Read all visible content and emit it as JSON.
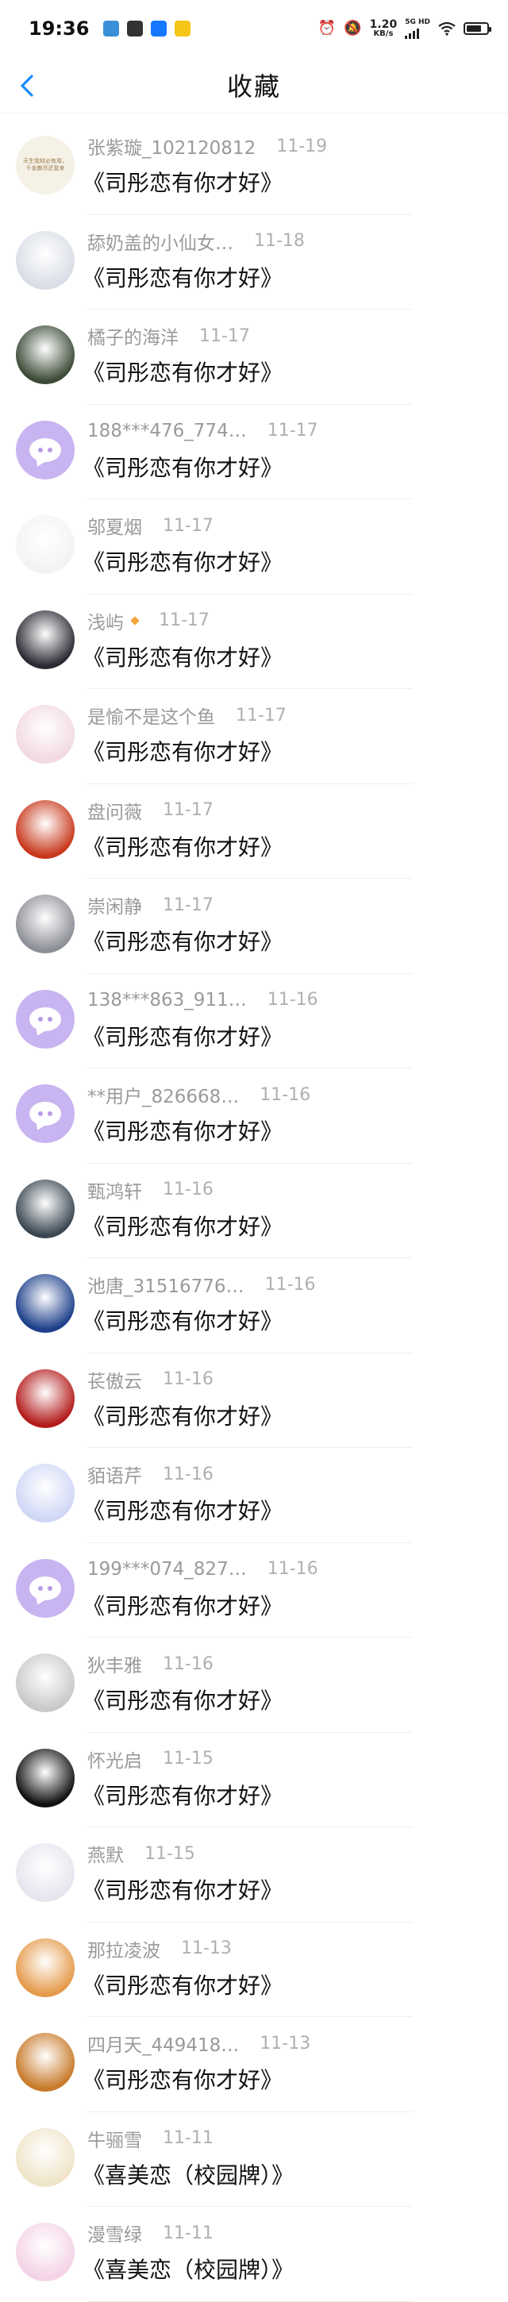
{
  "status_bar": {
    "time": "19:36",
    "net_speed": "1.20",
    "net_unit": "KB/s",
    "signal_badge": "5G HD",
    "app_icons": [
      {
        "name": "cloud-app-icon",
        "color": "#3a8fd9"
      },
      {
        "name": "mail-app-icon",
        "color": "#333333"
      },
      {
        "name": "bluetooth-app-icon",
        "color": "#1677ff"
      },
      {
        "name": "notes-app-icon",
        "color": "#f5c518"
      }
    ],
    "battery_level": 0.75
  },
  "header": {
    "back_icon": "chevron-left-icon",
    "title": "收藏",
    "accent_color": "#1a8cff"
  },
  "favorites": [
    {
      "name": "张紫璇_102120812",
      "date": "11-19",
      "title": "《司彤恋有你才好》",
      "avatar": {
        "type": "text",
        "bg": "#f6f1e6",
        "text": "天生我材必有用，千金散尽还复来"
      }
    },
    {
      "name": "舔奶盖的小仙女…",
      "date": "11-18",
      "title": "《司彤恋有你才好》",
      "avatar": {
        "type": "photo",
        "bg": "#d9dde5"
      }
    },
    {
      "name": "橘子的海洋",
      "date": "11-17",
      "title": "《司彤恋有你才好》",
      "avatar": {
        "type": "photo",
        "bg": "#3b4a36"
      }
    },
    {
      "name": "188***476_774…",
      "date": "11-17",
      "title": "《司彤恋有你才好》",
      "avatar": {
        "type": "default"
      }
    },
    {
      "name": "邬夏烟",
      "date": "11-17",
      "title": "《司彤恋有你才好》",
      "avatar": {
        "type": "photo",
        "bg": "#f3f3f3"
      }
    },
    {
      "name": "浅屿",
      "date": "11-17",
      "title": "《司彤恋有你才好》",
      "badge": true,
      "avatar": {
        "type": "photo",
        "bg": "#2a2a33"
      }
    },
    {
      "name": "是愉不是这个鱼",
      "date": "11-17",
      "title": "《司彤恋有你才好》",
      "avatar": {
        "type": "photo",
        "bg": "#f2d9e2"
      }
    },
    {
      "name": "盘问薇",
      "date": "11-17",
      "title": "《司彤恋有你才好》",
      "avatar": {
        "type": "photo",
        "bg": "#c8381c"
      }
    },
    {
      "name": "崇闲静",
      "date": "11-17",
      "title": "《司彤恋有你才好》",
      "avatar": {
        "type": "photo",
        "bg": "#8d8f96"
      }
    },
    {
      "name": "138***863_911…",
      "date": "11-16",
      "title": "《司彤恋有你才好》",
      "avatar": {
        "type": "default"
      }
    },
    {
      "name": "**用户_826668…",
      "date": "11-16",
      "title": "《司彤恋有你才好》",
      "avatar": {
        "type": "default"
      }
    },
    {
      "name": "甄鸿轩",
      "date": "11-16",
      "title": "《司彤恋有你才好》",
      "avatar": {
        "type": "photo",
        "bg": "#3a4752"
      }
    },
    {
      "name": "池唐_31516776…",
      "date": "11-16",
      "title": "《司彤恋有你才好》",
      "avatar": {
        "type": "photo",
        "bg": "#1d3f8a"
      }
    },
    {
      "name": "苌傲云",
      "date": "11-16",
      "title": "《司彤恋有你才好》",
      "avatar": {
        "type": "photo",
        "bg": "#b31b1b"
      }
    },
    {
      "name": "貊语芹",
      "date": "11-16",
      "title": "《司彤恋有你才好》",
      "avatar": {
        "type": "photo",
        "bg": "#cfd7f5"
      }
    },
    {
      "name": "199***074_827…",
      "date": "11-16",
      "title": "《司彤恋有你才好》",
      "avatar": {
        "type": "default"
      }
    },
    {
      "name": "狄丰雅",
      "date": "11-16",
      "title": "《司彤恋有你才好》",
      "avatar": {
        "type": "photo",
        "bg": "#c9c9c9"
      }
    },
    {
      "name": "怀光启",
      "date": "11-15",
      "title": "《司彤恋有你才好》",
      "avatar": {
        "type": "photo",
        "bg": "#111111"
      }
    },
    {
      "name": "燕默",
      "date": "11-15",
      "title": "《司彤恋有你才好》",
      "avatar": {
        "type": "photo",
        "bg": "#e8e4ee"
      }
    },
    {
      "name": "那拉凌波",
      "date": "11-13",
      "title": "《司彤恋有你才好》",
      "avatar": {
        "type": "photo",
        "bg": "#e59a4a"
      }
    },
    {
      "name": "四月天_449418…",
      "date": "11-13",
      "title": "《司彤恋有你才好》",
      "avatar": {
        "type": "photo",
        "bg": "#c87a2a"
      }
    },
    {
      "name": "牛骊雪",
      "date": "11-11",
      "title": "《喜美恋（校园牌）》",
      "avatar": {
        "type": "photo",
        "bg": "#efe4c8"
      }
    },
    {
      "name": "漫雪绿",
      "date": "11-11",
      "title": "《喜美恋（校园牌）》",
      "avatar": {
        "type": "photo",
        "bg": "#f4d3e6"
      }
    }
  ]
}
